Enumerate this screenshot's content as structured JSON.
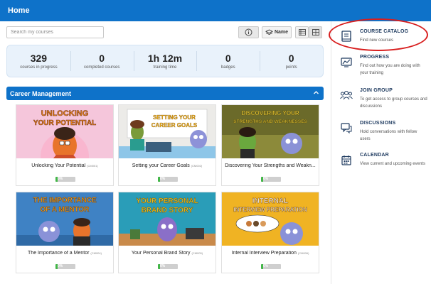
{
  "header": {
    "title": "Home"
  },
  "toolbar": {
    "search_placeholder": "Search my courses",
    "sort_label": "Name",
    "info_icon": "info-icon",
    "list_icon": "list-view-icon",
    "grid_icon": "grid-view-icon"
  },
  "stats": [
    {
      "value": "329",
      "label": "courses in progress"
    },
    {
      "value": "0",
      "label": "completed courses"
    },
    {
      "value": "1h 12m",
      "label": "training time"
    },
    {
      "value": "0",
      "label": "badges"
    },
    {
      "value": "0",
      "label": "points"
    }
  ],
  "section": {
    "title": "Career Management",
    "icon": "chevron-up-icon"
  },
  "courses": [
    {
      "title": "Unlocking Your Potential",
      "code": "(CM001)",
      "progress_label": "0%",
      "progress": 0,
      "thumb_text": [
        "UNLOCKING",
        "YOUR POTENTIAL"
      ],
      "thumb_color": "#f7c9dc"
    },
    {
      "title": "Setting your Career Goals",
      "code": "(CM002)",
      "progress_label": "0%",
      "progress": 0,
      "thumb_text": [
        "SETTING YOUR",
        "CAREER GOALS"
      ],
      "thumb_color": "#eeeae6"
    },
    {
      "title": "Discovering Your Strengths and Weakn...",
      "code": "",
      "progress_label": "0%",
      "progress": 0,
      "thumb_text": [
        "DISCOVERING YOUR",
        "STRENGTHS AND WEAKNESSES"
      ],
      "thumb_color": "#6b6a2a"
    },
    {
      "title": "The Importance of a Mentor",
      "code": "(CM004)",
      "progress_label": "0%",
      "progress": 0,
      "thumb_text": [
        "THE IMPORTANCE",
        "OF A MENTOR"
      ],
      "thumb_color": "#3f82c4"
    },
    {
      "title": "Your Personal Brand Story",
      "code": "(CM005)",
      "progress_label": "0%",
      "progress": 0,
      "thumb_text": [
        "YOUR PERSONAL",
        "BRAND STORY"
      ],
      "thumb_color": "#2a9db8"
    },
    {
      "title": "Internal Interview Preparation",
      "code": "(CM006)",
      "progress_label": "0%",
      "progress": 0,
      "thumb_text": [
        "INTERNAL",
        "INTERVIEW PREPARATION"
      ],
      "thumb_color": "#f0b323"
    }
  ],
  "sidebar": [
    {
      "title": "COURSE CATALOG",
      "desc": "Find new courses",
      "icon": "book-icon"
    },
    {
      "title": "PROGRESS",
      "desc": "Find out how you are doing with your training",
      "icon": "progress-chart-icon"
    },
    {
      "title": "JOIN GROUP",
      "desc": "To get access to group courses and discussions",
      "icon": "group-icon"
    },
    {
      "title": "DISCUSSIONS",
      "desc": "Hold conversations with fellow users",
      "icon": "chat-icon"
    },
    {
      "title": "CALENDAR",
      "desc": "View current and upcoming events",
      "icon": "calendar-icon"
    }
  ],
  "colors": {
    "brand": "#0e72c9",
    "highlight": "#d81e1e",
    "progress": "#43b649"
  }
}
